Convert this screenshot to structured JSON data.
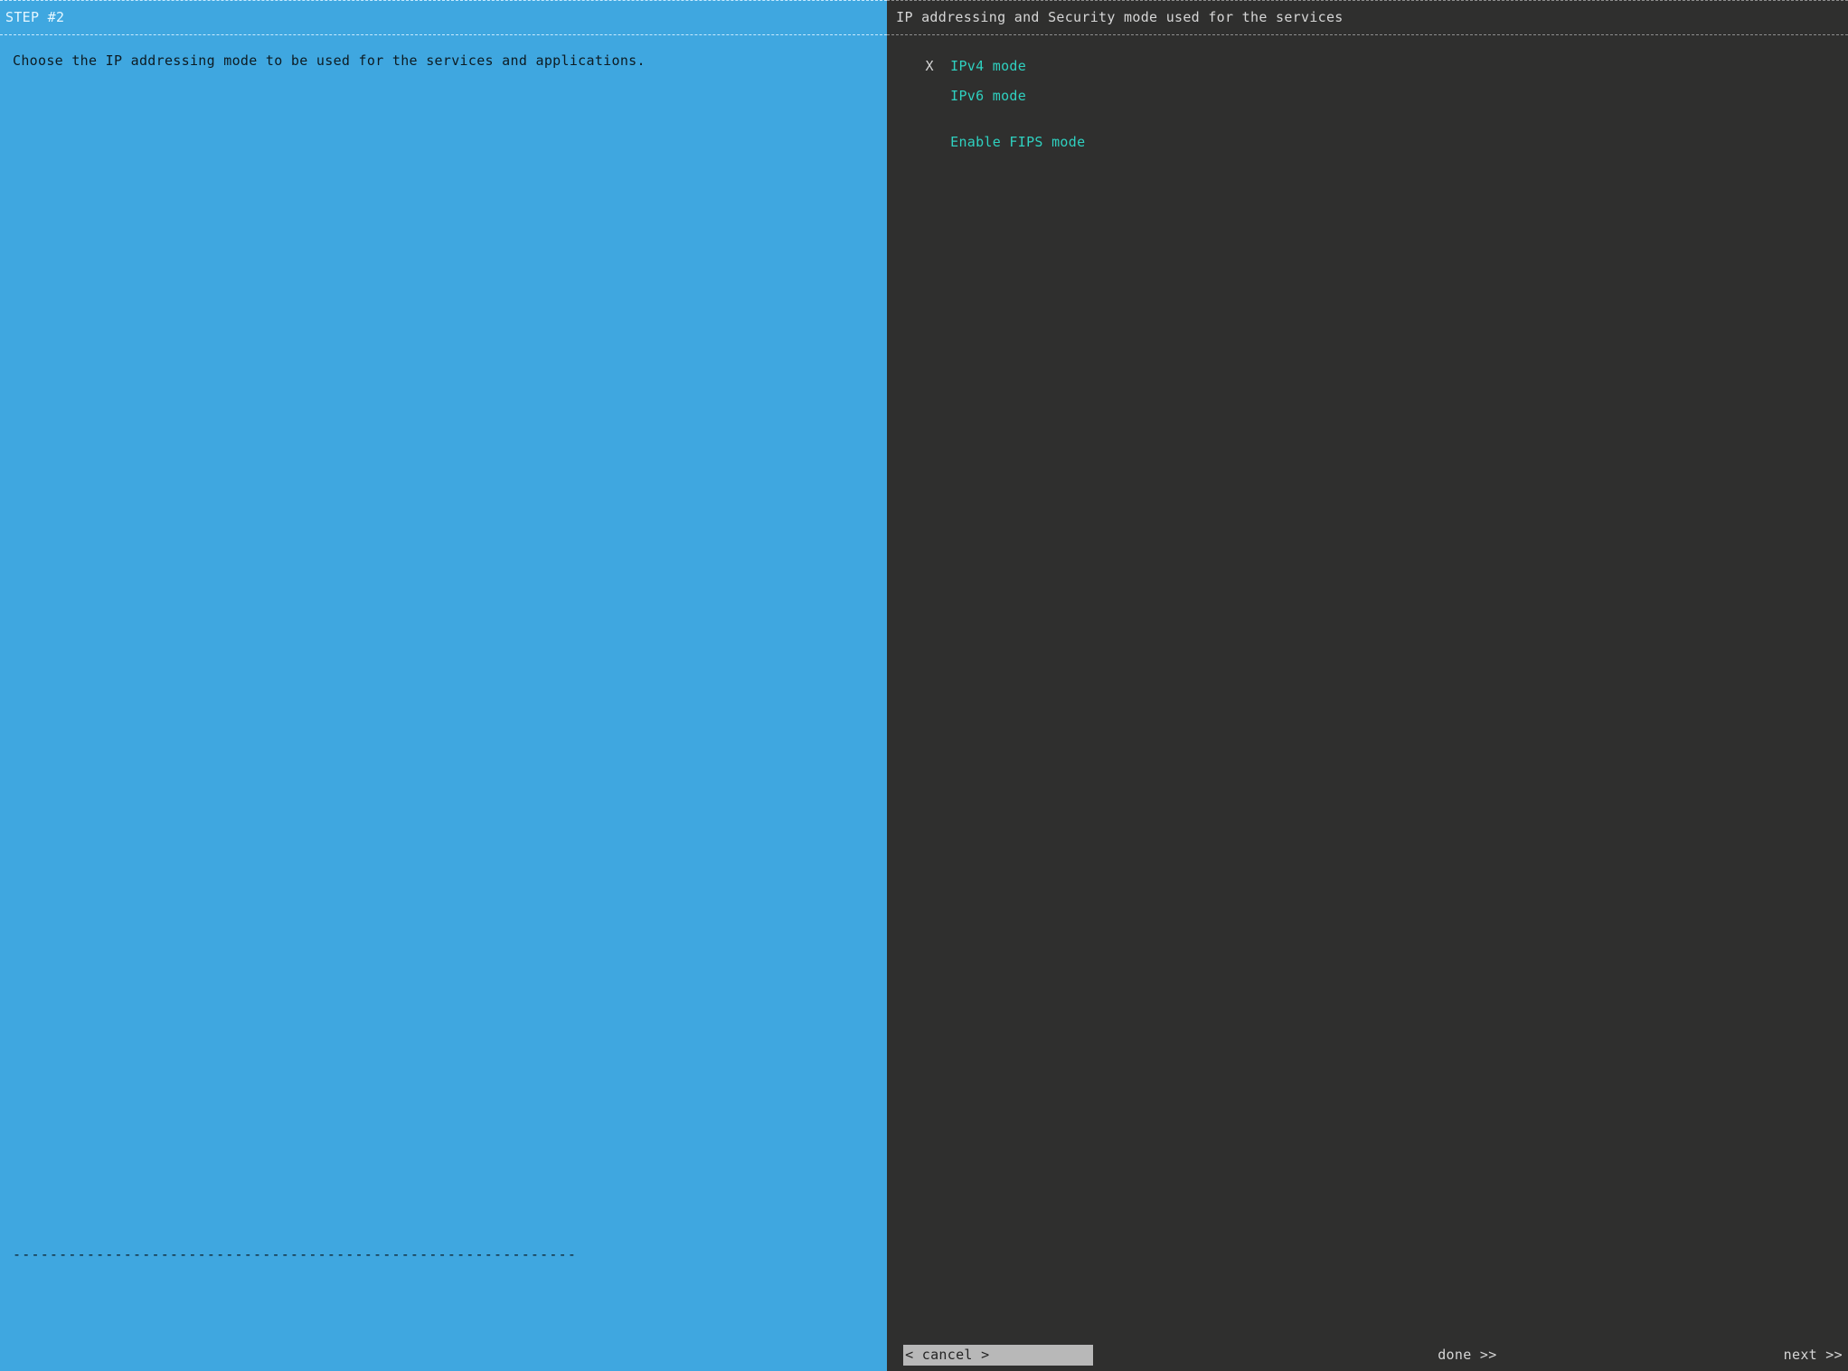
{
  "left": {
    "title": "STEP #2",
    "description": "Choose the IP addressing mode to be used for the services and applications.",
    "rule": "-------------------------------------------------------------"
  },
  "right": {
    "title": "IP addressing and Security mode used for the services",
    "options": [
      {
        "mark": "X",
        "label": "IPv4 mode"
      },
      {
        "mark": "",
        "label": "IPv6 mode"
      },
      {
        "mark": "",
        "label": "Enable FIPS mode"
      }
    ]
  },
  "footer": {
    "cancel": "< cancel >",
    "done": "done >>",
    "next": "next >>"
  }
}
